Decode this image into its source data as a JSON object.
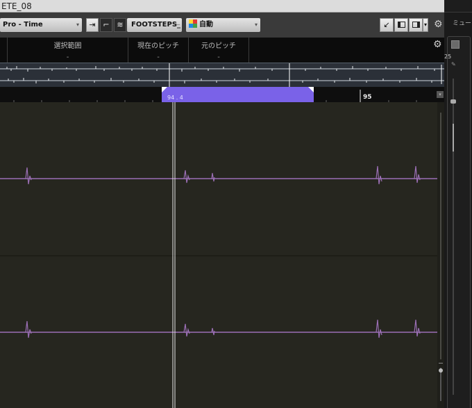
{
  "window": {
    "title": "ETE_08"
  },
  "toolbar": {
    "time_format": "Pro - Time",
    "track_name": "FOOTSTEPS_",
    "track_name_arrow": "⊢",
    "pitch_mode": "自動",
    "icon_solo": "⇥",
    "icon_bracket": "⌐",
    "icon_layers": "≋",
    "icon_arrow": "↙"
  },
  "infobar": {
    "selection_label": "選択範囲",
    "selection_value": "-",
    "current_pitch_label": "現在のピッチ",
    "current_pitch_value": "-",
    "original_pitch_label": "元のピッチ",
    "original_pitch_value": "-"
  },
  "ruler": {
    "marker_95": "95",
    "selection_position": "94 . 4"
  },
  "right_panel": {
    "mixer_label": "ミュー",
    "level_label": "25"
  },
  "colors": {
    "selection": "#7a62e8",
    "waveform": "#9b6fb5",
    "editor_bg": "#26261f"
  }
}
